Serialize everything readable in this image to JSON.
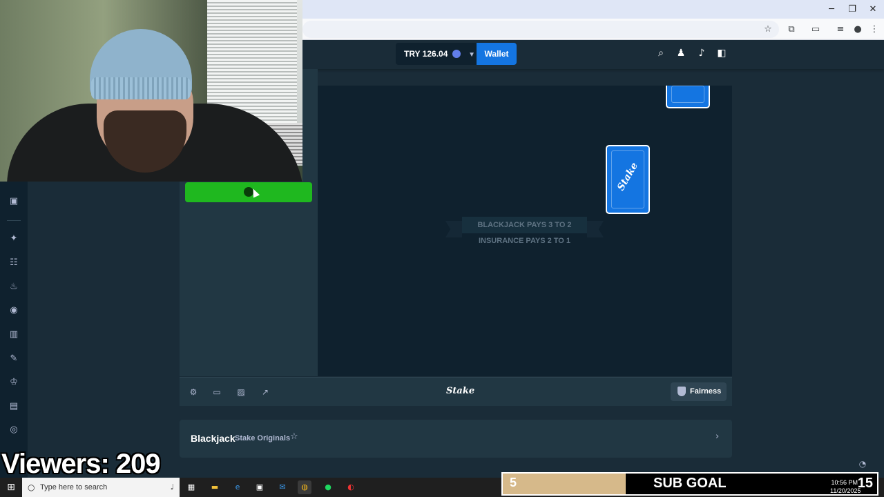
{
  "browser": {
    "window_controls": [
      "─",
      "❐",
      "✕"
    ]
  },
  "header": {
    "balance_currency": "TRY",
    "balance_amount": "126.04",
    "balance_display": "TRY 126.04",
    "wallet_label": "Wallet"
  },
  "table": {
    "rule_line1": "BLACKJACK PAYS 3 TO 2",
    "rule_line2": "INSURANCE PAYS 2 TO 1",
    "card_logo": "Stake"
  },
  "game_footer": {
    "logo": "Stake",
    "fairness_label": "Fairness"
  },
  "game_info": {
    "title": "Blackjack",
    "subtitle": "Stake Originals"
  },
  "overlay": {
    "viewers": "Viewers: 209",
    "subgoal_current": "5",
    "subgoal_label": "SUB GOAL",
    "subgoal_target": "15"
  },
  "taskbar": {
    "search_placeholder": "Type here to search",
    "time": "10:56 PM",
    "date": "11/20/2025"
  },
  "colors": {
    "accent_blue": "#1475e1",
    "play_green": "#1fb81f",
    "bg_dark": "#0f212e",
    "bg_panel": "#213743"
  }
}
